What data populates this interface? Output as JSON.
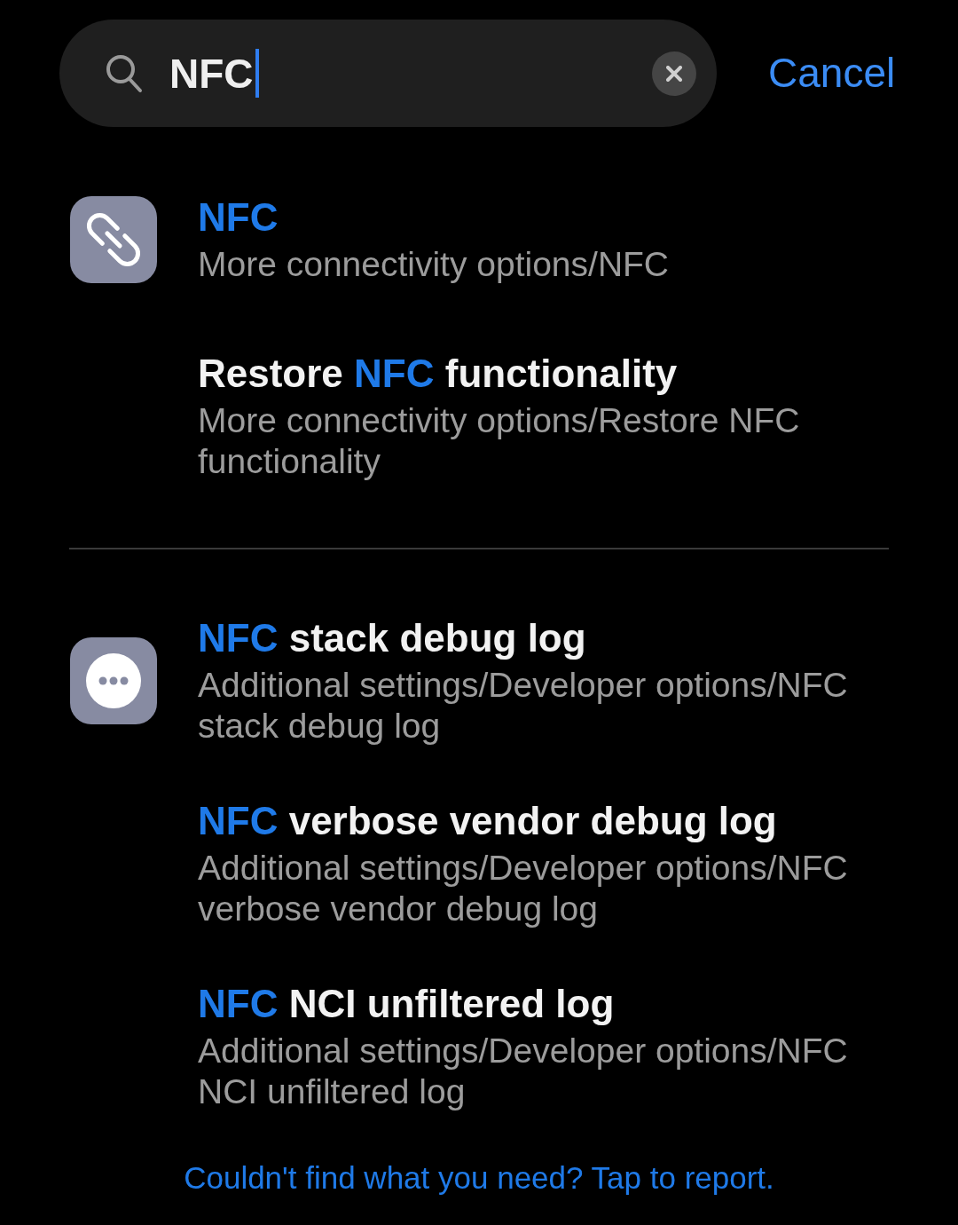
{
  "search": {
    "value": "NFC",
    "cancel": "Cancel"
  },
  "groups": [
    {
      "results": [
        {
          "title": [
            {
              "text": "NFC",
              "highlight": true
            }
          ],
          "path": "More connectivity options/NFC"
        },
        {
          "title": [
            {
              "text": "Restore ",
              "highlight": false
            },
            {
              "text": "NFC",
              "highlight": true
            },
            {
              "text": " functionality",
              "highlight": false
            }
          ],
          "path": "More connectivity options/Restore NFC functionality"
        }
      ]
    },
    {
      "results": [
        {
          "title": [
            {
              "text": "NFC",
              "highlight": true
            },
            {
              "text": " stack debug log",
              "highlight": false
            }
          ],
          "path": "Additional settings/Developer options/NFC stack debug log"
        },
        {
          "title": [
            {
              "text": "NFC",
              "highlight": true
            },
            {
              "text": " verbose vendor debug log",
              "highlight": false
            }
          ],
          "path": "Additional settings/Developer options/NFC verbose vendor debug log"
        },
        {
          "title": [
            {
              "text": "NFC",
              "highlight": true
            },
            {
              "text": " NCI unfiltered log",
              "highlight": false
            }
          ],
          "path": "Additional settings/Developer options/NFC NCI unfiltered log"
        }
      ]
    }
  ],
  "footer": "Couldn't find what you need? Tap to report."
}
